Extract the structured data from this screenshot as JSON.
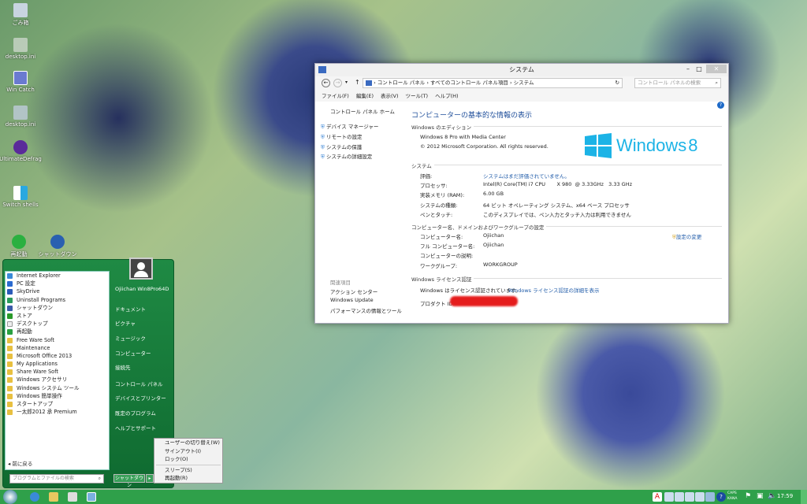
{
  "desktop": {
    "icons": [
      {
        "label": "ごみ箱"
      },
      {
        "label": "desktop.ini"
      },
      {
        "label": "Win Catch"
      },
      {
        "label": "desktop.ini"
      },
      {
        "label": "UltimateDefrag"
      },
      {
        "label": "Switch shells"
      },
      {
        "label": "再起動"
      },
      {
        "label": "シャットダウン"
      }
    ]
  },
  "window": {
    "title": "システム",
    "breadcrumb": [
      "コントロール パネル",
      "すべてのコントロール パネル項目",
      "システム"
    ],
    "search_placeholder": "コントロール パネルの検索",
    "menu": [
      "ファイル(F)",
      "編集(E)",
      "表示(V)",
      "ツール(T)",
      "ヘルプ(H)"
    ],
    "left": {
      "home": "コントロール パネル ホーム",
      "links": [
        "デバイス マネージャー",
        "リモートの設定",
        "システムの保護",
        "システムの詳細設定"
      ],
      "related_title": "関連項目",
      "related": [
        "アクション センター",
        "Windows Update",
        "パフォーマンスの情報とツール"
      ]
    },
    "heading": "コンピューターの基本的な情報の表示",
    "edition": {
      "title": "Windows のエディション",
      "name": "Windows 8 Pro with Media Center",
      "copyright": "© 2012 Microsoft Corporation. All rights reserved.",
      "logo": "Windows 8"
    },
    "system": {
      "title": "システム",
      "rows": [
        {
          "k": "評価:",
          "v": "システムはまだ評価されていません。"
        },
        {
          "k": "プロセッサ:",
          "v": "Intel(R) Core(TM) i7 CPU       X 980  @ 3.33GHz   3.33 GHz"
        },
        {
          "k": "実装メモリ (RAM):",
          "v": "6.00 GB"
        },
        {
          "k": "システムの種類:",
          "v": "64 ビット オペレーティング システム、x64 ベース プロセッサ"
        },
        {
          "k": "ペンとタッチ:",
          "v": "このディスプレイでは、ペン入力とタッチ入力は利用できません"
        }
      ]
    },
    "computer": {
      "title": "コンピューター名、ドメインおよびワークグループの設定",
      "change": "設定の変更",
      "rows": [
        {
          "k": "コンピューター名:",
          "v": "Ojiichan"
        },
        {
          "k": "フル コンピューター名:",
          "v": "Ojiichan"
        },
        {
          "k": "コンピューターの説明:",
          "v": ""
        },
        {
          "k": "ワークグループ:",
          "v": "WORKGROUP"
        }
      ]
    },
    "license": {
      "title": "Windows ライセンス認証",
      "status": "Windows はライセンス認証されています。",
      "details": "Windows ライセンス認証の詳細を表示",
      "product_id_label": "プロダクト ID:"
    }
  },
  "start": {
    "programs": [
      "Internet Explorer",
      "PC 設定",
      "SkyDrive",
      "Uninstall Programs",
      "シャットダウン",
      "ストア",
      "デスクトップ",
      "再起動",
      "Free Ware Soft",
      "Maintenance",
      "Microsoft Office 2013",
      "My Applications",
      "Share Ware Soft",
      "Windows アクセサリ",
      "Windows システム ツール",
      "Windows 簡単操作",
      "スタートアップ",
      "一太郎2012 承 Premium"
    ],
    "back": "前に戻る",
    "search_placeholder": "プログラムとファイルの検索",
    "user": "Ojiichan Win8Pro64D",
    "right": [
      "ドキュメント",
      "ピクチャ",
      "ミュージック",
      "コンピューター",
      "接続先",
      "コントロール パネル",
      "デバイスとプリンター",
      "既定のプログラム",
      "ヘルプとサポート"
    ],
    "shutdown": "シャットダウン",
    "context": [
      "ユーザーの切り替え(W)",
      "サインアウト(I)",
      "ロック(O)",
      "スリープ(S)",
      "再起動(R)"
    ]
  },
  "taskbar": {
    "clock": "17:59",
    "ime_top": "CAPS",
    "ime_bottom": "KANA"
  }
}
